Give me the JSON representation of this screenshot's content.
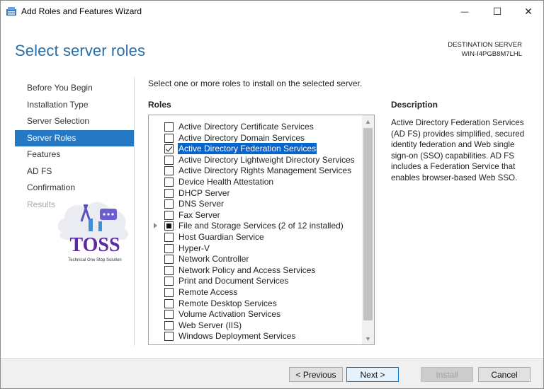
{
  "window": {
    "title": "Add Roles and Features Wizard",
    "minimize_glyph": "—",
    "maximize_glyph": "☐",
    "close_glyph": "✕"
  },
  "header": {
    "page_title": "Select server roles",
    "destination_label": "DESTINATION SERVER",
    "destination_server": "WIN-I4PGB8M7LHL"
  },
  "nav": {
    "items": [
      {
        "label": "Before You Begin",
        "state": "normal"
      },
      {
        "label": "Installation Type",
        "state": "normal"
      },
      {
        "label": "Server Selection",
        "state": "normal"
      },
      {
        "label": "Server Roles",
        "state": "active"
      },
      {
        "label": "Features",
        "state": "normal"
      },
      {
        "label": "AD FS",
        "state": "normal"
      },
      {
        "label": "Confirmation",
        "state": "normal"
      },
      {
        "label": "Results",
        "state": "disabled"
      }
    ]
  },
  "logo": {
    "text": "TOSS",
    "tagline": "Technical One Stop Solution"
  },
  "main": {
    "instruction": "Select one or more roles to install on the selected server.",
    "roles_heading": "Roles",
    "description_heading": "Description",
    "description_text": "Active Directory Federation Services (AD FS) provides simplified, secured identity federation and Web single sign-on (SSO) capabilities. AD FS includes a Federation Service that enables browser-based Web SSO."
  },
  "roles": [
    {
      "label": "Active Directory Certificate Services",
      "state": "unchecked",
      "expandable": false,
      "selected": false
    },
    {
      "label": "Active Directory Domain Services",
      "state": "unchecked",
      "expandable": false,
      "selected": false
    },
    {
      "label": "Active Directory Federation Services",
      "state": "checked",
      "expandable": false,
      "selected": true
    },
    {
      "label": "Active Directory Lightweight Directory Services",
      "state": "unchecked",
      "expandable": false,
      "selected": false
    },
    {
      "label": "Active Directory Rights Management Services",
      "state": "unchecked",
      "expandable": false,
      "selected": false
    },
    {
      "label": "Device Health Attestation",
      "state": "unchecked",
      "expandable": false,
      "selected": false
    },
    {
      "label": "DHCP Server",
      "state": "unchecked",
      "expandable": false,
      "selected": false
    },
    {
      "label": "DNS Server",
      "state": "unchecked",
      "expandable": false,
      "selected": false
    },
    {
      "label": "Fax Server",
      "state": "unchecked",
      "expandable": false,
      "selected": false
    },
    {
      "label": "File and Storage Services (2 of 12 installed)",
      "state": "partial",
      "expandable": true,
      "selected": false
    },
    {
      "label": "Host Guardian Service",
      "state": "unchecked",
      "expandable": false,
      "selected": false
    },
    {
      "label": "Hyper-V",
      "state": "unchecked",
      "expandable": false,
      "selected": false
    },
    {
      "label": "Network Controller",
      "state": "unchecked",
      "expandable": false,
      "selected": false
    },
    {
      "label": "Network Policy and Access Services",
      "state": "unchecked",
      "expandable": false,
      "selected": false
    },
    {
      "label": "Print and Document Services",
      "state": "unchecked",
      "expandable": false,
      "selected": false
    },
    {
      "label": "Remote Access",
      "state": "unchecked",
      "expandable": false,
      "selected": false
    },
    {
      "label": "Remote Desktop Services",
      "state": "unchecked",
      "expandable": false,
      "selected": false
    },
    {
      "label": "Volume Activation Services",
      "state": "unchecked",
      "expandable": false,
      "selected": false
    },
    {
      "label": "Web Server (IIS)",
      "state": "unchecked",
      "expandable": false,
      "selected": false
    },
    {
      "label": "Windows Deployment Services",
      "state": "unchecked",
      "expandable": false,
      "selected": false
    }
  ],
  "buttons": {
    "previous": "< Previous",
    "next": "Next >",
    "install": "Install",
    "cancel": "Cancel"
  },
  "colors": {
    "accent": "#2478c4",
    "title_blue": "#2b6ea6",
    "selection": "#0a64c8"
  }
}
